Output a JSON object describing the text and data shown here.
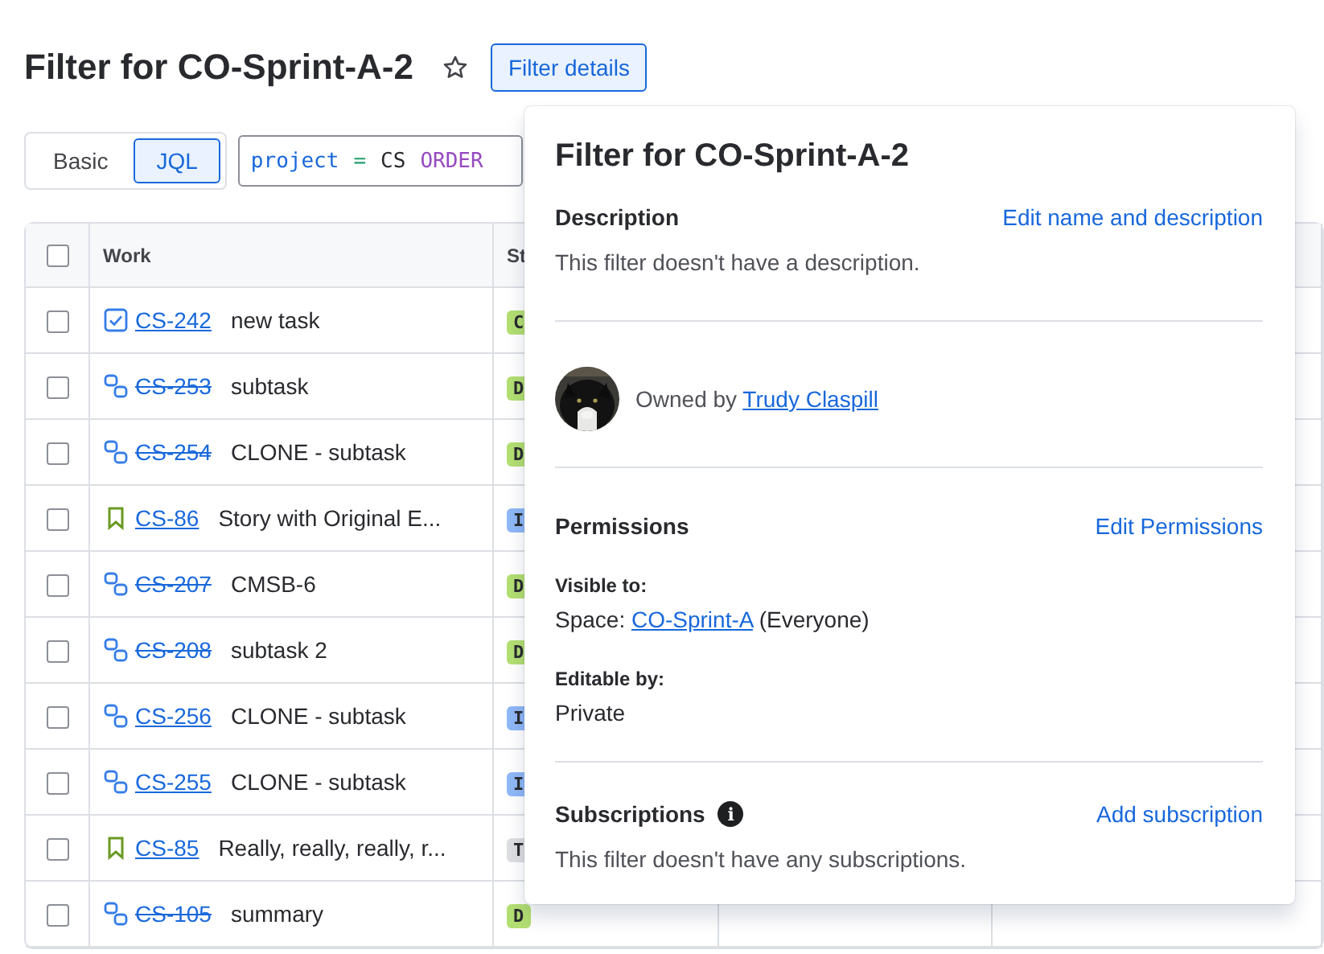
{
  "header": {
    "title": "Filter for CO-Sprint-A-2",
    "starred": false,
    "details_button": "Filter details"
  },
  "search_mode": [
    {
      "label": "Basic",
      "selected": false
    },
    {
      "label": "JQL",
      "selected": true
    }
  ],
  "jql": [
    {
      "kind": "field",
      "text": "project"
    },
    {
      "kind": "operator",
      "text": "="
    },
    {
      "kind": "value",
      "text": "CS"
    },
    {
      "kind": "keyword",
      "text": "ORDER"
    }
  ],
  "table": {
    "all_selected": false,
    "columns": [
      "Work",
      "St"
    ],
    "rows": [
      {
        "selected": false,
        "kind": "task",
        "key": "CS-242",
        "resolved": false,
        "summary": "new task",
        "status": "C",
        "color": "#b3df72"
      },
      {
        "selected": false,
        "kind": "subtask",
        "key": "CS-253",
        "resolved": true,
        "summary": "subtask",
        "status": "D",
        "color": "#b3df72"
      },
      {
        "selected": false,
        "kind": "subtask",
        "key": "CS-254",
        "resolved": true,
        "summary": "CLONE - subtask",
        "status": "D",
        "color": "#b3df72"
      },
      {
        "selected": false,
        "kind": "story",
        "key": "CS-86",
        "resolved": false,
        "summary": "Story with Original E...",
        "status": "I",
        "color": "#8fb8f6"
      },
      {
        "selected": false,
        "kind": "subtask",
        "key": "CS-207",
        "resolved": true,
        "summary": "CMSB-6",
        "status": "D",
        "color": "#b3df72"
      },
      {
        "selected": false,
        "kind": "subtask",
        "key": "CS-208",
        "resolved": true,
        "summary": "subtask 2",
        "status": "D",
        "color": "#b3df72"
      },
      {
        "selected": false,
        "kind": "subtask",
        "key": "CS-256",
        "resolved": false,
        "summary": "CLONE - subtask",
        "status": "I",
        "color": "#8fb8f6"
      },
      {
        "selected": false,
        "kind": "subtask",
        "key": "CS-255",
        "resolved": false,
        "summary": "CLONE - subtask",
        "status": "I",
        "color": "#8fb8f6"
      },
      {
        "selected": false,
        "kind": "story",
        "key": "CS-85",
        "resolved": false,
        "summary": "Really, really, really, r...",
        "status": "T",
        "color": "#dddee1"
      },
      {
        "selected": false,
        "kind": "subtask",
        "key": "CS-105",
        "resolved": true,
        "summary": "summary",
        "status": "D",
        "color": "#b3df72"
      }
    ]
  },
  "popover": {
    "title": "Filter for CO-Sprint-A-2",
    "description": {
      "heading": "Description",
      "action": "Edit name and description",
      "text": "This filter doesn't have a description."
    },
    "owner": {
      "prefix": "Owned by",
      "name": "Trudy Claspill"
    },
    "permissions": {
      "heading": "Permissions",
      "action": "Edit Permissions",
      "visible_label": "Visible to:",
      "visible_prefix": "Space:",
      "visible_link": "CO-Sprint-A",
      "visible_suffix": "(Everyone)",
      "editable_label": "Editable by:",
      "editable_value": "Private"
    },
    "subscriptions": {
      "heading": "Subscriptions",
      "info": "i",
      "action": "Add subscription",
      "text": "This filter doesn't have any subscriptions."
    }
  }
}
